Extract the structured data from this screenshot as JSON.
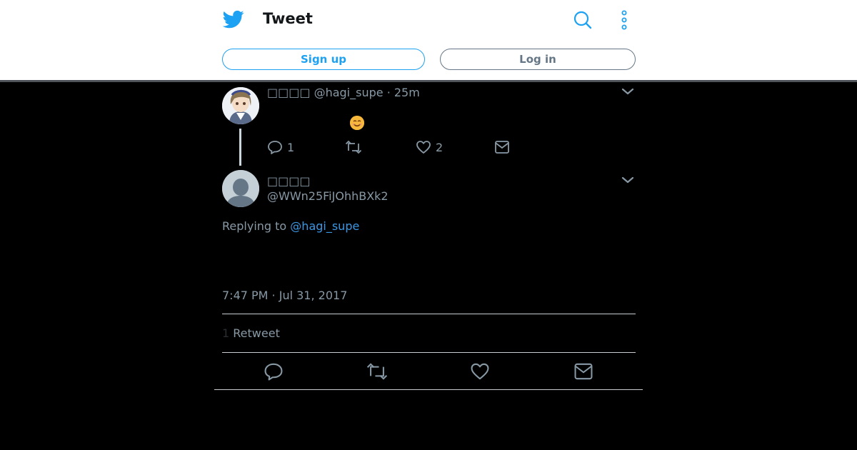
{
  "header": {
    "title": "Tweet",
    "signup_label": "Sign up",
    "login_label": "Log in"
  },
  "parent_tweet": {
    "display_name": "□□□□",
    "handle": "@hagi_supe",
    "time": "25m",
    "emoji": "😊",
    "reply_count": "1",
    "like_count": "2"
  },
  "main_tweet": {
    "display_name": "□□□□",
    "handle": "@WWn25FiJOhhBXk2",
    "replying_prefix": "Replying to",
    "replying_handle": "@hagi_supe",
    "timestamp": "7:47 PM · Jul 31, 2017",
    "retweet_count": "1",
    "retweet_label": "Retweet"
  },
  "colors": {
    "accent": "#1da1f2",
    "link": "#3c97e3",
    "secondary_text": "#8899a6",
    "background": "#000000"
  },
  "icons": [
    "twitter-logo-icon",
    "search-icon",
    "more-vertical-icon",
    "chevron-down-icon",
    "reply-icon",
    "retweet-icon",
    "like-icon",
    "message-icon"
  ]
}
